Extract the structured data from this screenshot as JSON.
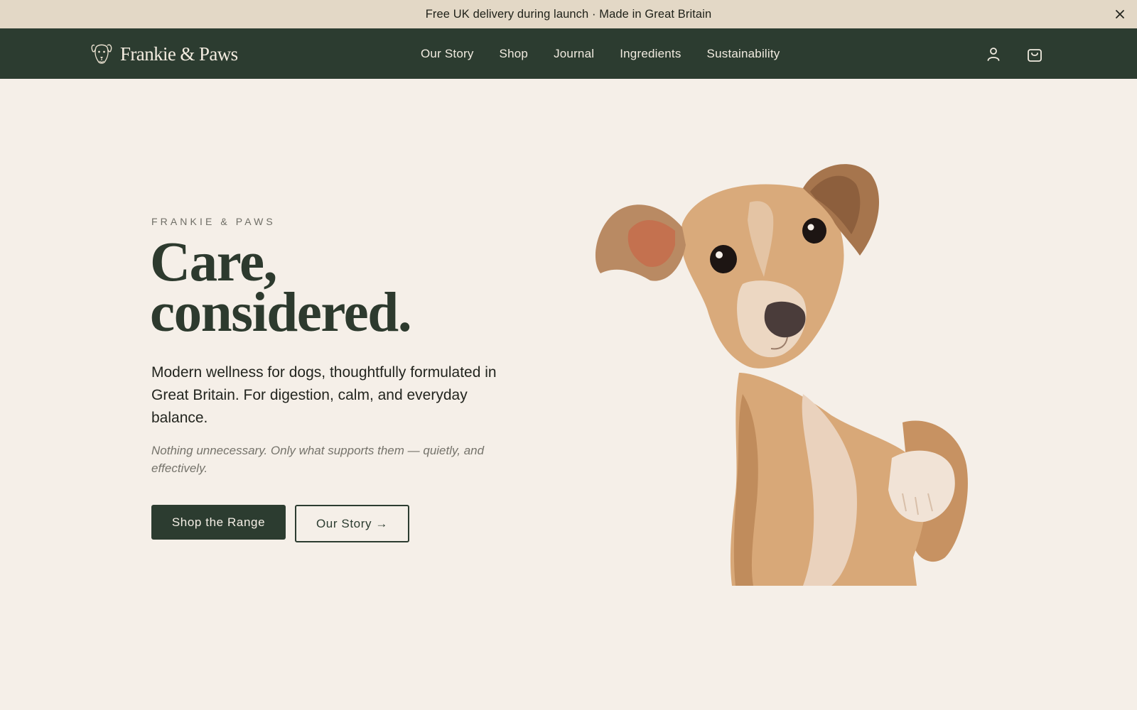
{
  "announcement": {
    "text": "Free UK delivery during launch · Made in Great Britain",
    "close_icon": "close-icon"
  },
  "header": {
    "logo_text": "Frankie & Paws",
    "nav": [
      {
        "label": "Our Story"
      },
      {
        "label": "Shop"
      },
      {
        "label": "Journal"
      },
      {
        "label": "Ingredients"
      },
      {
        "label": "Sustainability"
      }
    ],
    "icons": [
      "user-icon",
      "shopping-bag-icon"
    ]
  },
  "hero": {
    "eyebrow": "FRANKIE & PAWS",
    "headline_line1": "Care,",
    "headline_line2": "considered.",
    "intro": "Modern wellness for dogs, thoughtfully formulated in Great Britain. For digestion, calm, and everyday balance.",
    "note": "Nothing unnecessary. Only what supports them — quietly, and effectively.",
    "primary_button": "Shop the Range",
    "secondary_button": "Our Story →",
    "image_subject": "dog-photo"
  },
  "colors": {
    "background": "#f5efe8",
    "announcement_bg": "#e3d8c6",
    "header_bg": "#2c3c30",
    "accent": "#2c3c30",
    "header_text": "#f1ebe0"
  }
}
